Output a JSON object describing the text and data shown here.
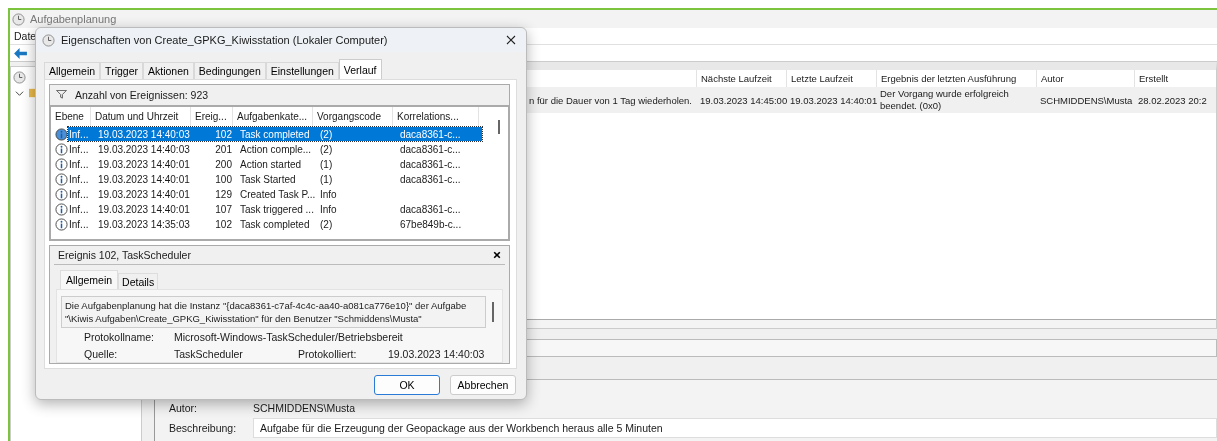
{
  "main_window": {
    "title": "Aufgabenplanung",
    "menu": [
      "Date"
    ],
    "tree": [
      {
        "expanded": true
      }
    ],
    "task_table": {
      "columns": [
        "Nächste Laufzeit",
        "Letzte Laufzeit",
        "Ergebnis der letzten Ausführung",
        "Autor",
        "Erstellt"
      ],
      "rows": [
        {
          "partial_cell": "n für die Dauer von 1 Tag wiederholen.",
          "cells": [
            "19.03.2023 14:45:00",
            "19.03.2023 14:40:01",
            "Der Vorgang wurde erfolgreich beendet. (0x0)",
            "SCHMIDDENS\\Musta",
            "28.02.2023 20:2"
          ]
        }
      ]
    },
    "details": [
      {
        "label": "Autor:",
        "value": "SCHMIDDENS\\Musta",
        "kind": "text"
      },
      {
        "label": "Beschreibung:",
        "value": "Aufgabe für die Erzeugung der Geopackage aus der Workbench heraus alle 5 Minuten",
        "kind": "box"
      }
    ]
  },
  "dialog": {
    "title": "Eigenschaften von Create_GPKG_Kiwisstation (Lokaler Computer)",
    "tabs": [
      {
        "label": "Allgemein",
        "selected": false
      },
      {
        "label": "Trigger",
        "selected": false
      },
      {
        "label": "Aktionen",
        "selected": false
      },
      {
        "label": "Bedingungen",
        "selected": false
      },
      {
        "label": "Einstellungen",
        "selected": false
      },
      {
        "label": "Verlauf",
        "selected": true
      }
    ],
    "filter_label": "Anzahl von Ereignissen: 923",
    "columns": [
      "Ebene",
      "Datum und Uhrzeit",
      "Ereig...",
      "Aufgabenkate...",
      "Vorgangscode",
      "Korrelations..."
    ],
    "rows": [
      {
        "level": "Inf...",
        "date": "19.03.2023 14:40:03",
        "id": "102",
        "category": "Task completed",
        "opcode": "(2)",
        "correlation": "daca8361-c...",
        "selected": true
      },
      {
        "level": "Inf...",
        "date": "19.03.2023 14:40:03",
        "id": "201",
        "category": "Action comple...",
        "opcode": "(2)",
        "correlation": "daca8361-c...",
        "selected": false
      },
      {
        "level": "Inf...",
        "date": "19.03.2023 14:40:01",
        "id": "200",
        "category": "Action started",
        "opcode": "(1)",
        "correlation": "daca8361-c...",
        "selected": false
      },
      {
        "level": "Inf...",
        "date": "19.03.2023 14:40:01",
        "id": "100",
        "category": "Task Started",
        "opcode": "(1)",
        "correlation": "daca8361-c...",
        "selected": false
      },
      {
        "level": "Inf...",
        "date": "19.03.2023 14:40:01",
        "id": "129",
        "category": "Created Task P...",
        "opcode": "Info",
        "selected": false
      },
      {
        "level": "Inf...",
        "date": "19.03.2023 14:40:01",
        "id": "107",
        "category": "Task triggered ...",
        "opcode": "Info",
        "correlation": "daca8361-c...",
        "selected": false
      },
      {
        "level": "Inf...",
        "date": "19.03.2023 14:35:03",
        "id": "102",
        "category": "Task completed",
        "opcode": "(2)",
        "correlation": "67be849b-c...",
        "selected": false
      }
    ],
    "event": {
      "title": "Ereignis 102, TaskScheduler",
      "tabs": [
        {
          "label": "Allgemein",
          "selected": true
        },
        {
          "label": "Details",
          "selected": false
        }
      ],
      "message": "Die Aufgabenplanung hat die Instanz \"{daca8361-c7af-4c4c-aa40-a081ca776e10}\" der Aufgabe \"\\Kiwis Aufgaben\\Create_GPKG_Kiwisstation\" für den Benutzer \"Schmiddens\\Musta\"",
      "log_name_label": "Protokollname:",
      "log_name": "Microsoft-Windows-TaskScheduler/Betriebsbereit",
      "source_label": "Quelle:",
      "source": "TaskScheduler",
      "logged_label": "Protokolliert:",
      "logged": "19.03.2023 14:40:03"
    },
    "buttons": [
      {
        "label": "OK",
        "default": true
      },
      {
        "label": "Abbrechen",
        "default": false
      }
    ]
  }
}
